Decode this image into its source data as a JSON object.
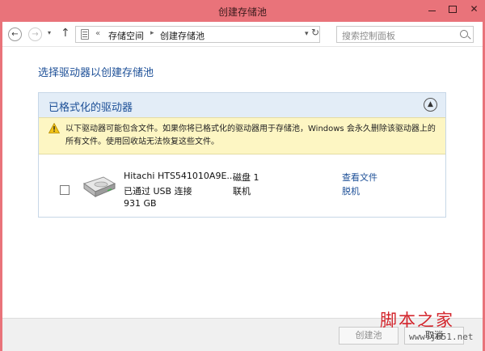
{
  "window": {
    "title": "创建存储池"
  },
  "toolbar": {
    "back_glyph": "←",
    "forward_glyph": "→",
    "dropdown_glyph": "▾",
    "up_glyph": "↑",
    "address_chevron": "«",
    "breadcrumb": [
      "存储空间",
      "创建存储池"
    ],
    "breadcrumb_sep": "▸",
    "refresh_glyph": "↻",
    "search_placeholder": "搜索控制面板"
  },
  "main": {
    "heading": "选择驱动器以创建存储池",
    "group": {
      "title": "已格式化的驱动器",
      "collapse_glyph": "▲",
      "warning": "以下驱动器可能包含文件。如果你将已格式化的驱动器用于存储池，Windows 会永久删除该驱动器上的所有文件。使用回收站无法恢复这些文件。",
      "drives": [
        {
          "name": "Hitachi HTS541010A9E...",
          "connection": "已通过 USB 连接",
          "size": "931 GB",
          "disk": "磁盘 1",
          "status": "联机",
          "link_view": "查看文件",
          "link_offline": "脱机",
          "checked": false
        }
      ]
    }
  },
  "footer": {
    "create_label": "创建池",
    "cancel_label": "取消"
  },
  "watermark": {
    "main": "脚本之家",
    "sub": "www.jb51.net"
  },
  "colors": {
    "titlebar": "#e9737a",
    "link": "#1c4f97",
    "warning_bg": "#fdf6c3",
    "group_header": "#e3edf7"
  }
}
